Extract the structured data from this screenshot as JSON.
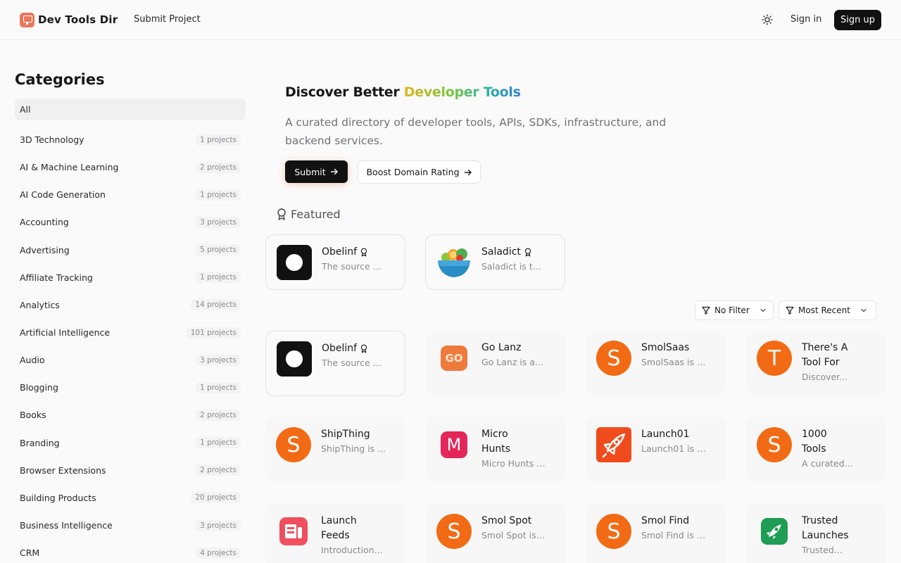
{
  "header": {
    "brand": "Dev Tools Dir",
    "nav_submit": "Submit Project",
    "signin": "Sign in",
    "signup": "Sign up"
  },
  "sidebar": {
    "title": "Categories",
    "items": [
      {
        "label": "All",
        "count": ""
      },
      {
        "label": "3D Technology",
        "count": "1 projects"
      },
      {
        "label": "AI & Machine Learning",
        "count": "2 projects"
      },
      {
        "label": "AI Code Generation",
        "count": "1 projects"
      },
      {
        "label": "Accounting",
        "count": "3 projects"
      },
      {
        "label": "Advertising",
        "count": "5 projects"
      },
      {
        "label": "Affiliate Tracking",
        "count": "1 projects"
      },
      {
        "label": "Analytics",
        "count": "14 projects"
      },
      {
        "label": "Artificial Intelligence",
        "count": "101 projects"
      },
      {
        "label": "Audio",
        "count": "3 projects"
      },
      {
        "label": "Blogging",
        "count": "1 projects"
      },
      {
        "label": "Books",
        "count": "2 projects"
      },
      {
        "label": "Branding",
        "count": "1 projects"
      },
      {
        "label": "Browser Extensions",
        "count": "2 projects"
      },
      {
        "label": "Building Products",
        "count": "20 projects"
      },
      {
        "label": "Business Intelligence",
        "count": "3 projects"
      },
      {
        "label": "CRM",
        "count": "4 projects"
      }
    ]
  },
  "hero": {
    "title_plain": "Discover Better ",
    "title_highlight": "Developer Tools",
    "description": "A curated directory of developer tools, APIs, SDKs, infrastructure, and backend services.",
    "submit_label": "Submit",
    "boost_label": "Boost Domain Rating"
  },
  "featured": {
    "label": "Featured",
    "cards": [
      {
        "name": "Obelinf",
        "desc": "The source o..."
      },
      {
        "name": "Saladict",
        "desc": "Saladict is th..."
      }
    ]
  },
  "filters": {
    "filter_label": "No Filter",
    "sort_label": "Most Recent"
  },
  "projects": [
    {
      "name": "Obelinf",
      "desc": "The source o..."
    },
    {
      "name": "Go Lanz",
      "desc": "Go Lanz is a..."
    },
    {
      "name": "SmolSaas",
      "desc": "SmolSaas is a..."
    },
    {
      "name": "There's A Tool For",
      "desc": "Discover..."
    },
    {
      "name": "ShipThing",
      "desc": "ShipThing is ..."
    },
    {
      "name": "Micro Hunts",
      "desc": "Micro Hunts i..."
    },
    {
      "name": "Launch01",
      "desc": "Launch01 is a..."
    },
    {
      "name": "1000 Tools",
      "desc": "A curated..."
    },
    {
      "name": "Launch Feeds",
      "desc": "Introduction..."
    },
    {
      "name": "Smol Spot",
      "desc": "Smol Spot is ..."
    },
    {
      "name": "Smol Find",
      "desc": "Smol Find is a..."
    },
    {
      "name": "Trusted Launches",
      "desc": "Trusted..."
    }
  ],
  "icons": {
    "go_text": "GO",
    "s_letter": "S",
    "t_letter": "T",
    "m_letter": "M"
  }
}
